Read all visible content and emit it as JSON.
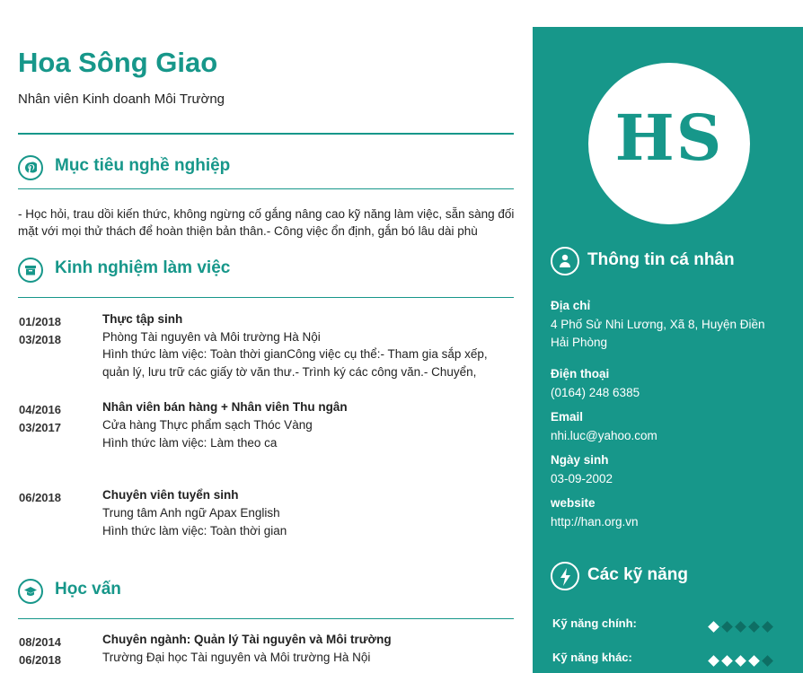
{
  "header": {
    "name": "Hoa Sông Giao",
    "position": "Nhân viên Kinh doanh Môi Trường"
  },
  "sections": {
    "objective": {
      "icon": "pinterest-icon",
      "title": "Mục tiêu nghề nghiệp",
      "text": "- Học hỏi, trau dồi kiến thức, không ngừng cố gắng nâng cao kỹ năng làm việc, sẵn sàng đối mặt với mọi thử thách để hoàn thiện bản thân.- Công việc ổn định, gắn bó lâu dài phù"
    },
    "experience": {
      "icon": "archive-icon",
      "title": "Kinh nghiệm làm việc",
      "items": [
        {
          "from": "01/2018",
          "to": "03/2018",
          "title": "Thực tập sinh",
          "org": "Phòng Tài nguyên và Môi trường Hà Nội",
          "desc": "Hình thức làm việc: Toàn thời gianCông việc cụ thể:- Tham gia sắp xếp, quản lý, lưu trữ các giấy tờ văn thư.- Trình ký các công văn.- Chuyển,"
        },
        {
          "from": "04/2016",
          "to": "03/2017",
          "title": "Nhân viên bán hàng + Nhân viên Thu ngân",
          "org": "Cửa hàng Thực phẩm sạch Thóc Vàng",
          "desc": "Hình thức làm việc: Làm theo ca"
        },
        {
          "from": "06/2018",
          "to": "",
          "title": "Chuyên viên tuyển sinh",
          "org": "Trung tâm Anh ngữ Apax English",
          "desc": "Hình thức làm việc: Toàn thời gian"
        }
      ]
    },
    "education": {
      "icon": "graduation-cap-icon",
      "title": "Học vấn",
      "items": [
        {
          "from": "08/2014",
          "to": "06/2018",
          "title": "Chuyên ngành: Quản lý Tài nguyên và Môi trường",
          "org": "Trường Đại học Tài nguyên và Môi trường Hà Nội"
        }
      ]
    }
  },
  "sidebar": {
    "initials": "HS",
    "personal_title": "Thông tin cá nhân",
    "personal_icon": "user-icon",
    "fields": [
      {
        "label": "Địa chỉ",
        "value": "4 Phố Sử Nhi Lương, Xã 8, Huyện Điền Hải Phòng"
      },
      {
        "label": "Điện thoại",
        "value": "(0164) 248 6385"
      },
      {
        "label": "Email",
        "value": "nhi.luc@yahoo.com"
      },
      {
        "label": "Ngày sinh",
        "value": "03-09-2002"
      },
      {
        "label": "website",
        "value": "http://han.org.vn"
      }
    ],
    "skills_title": "Các kỹ năng",
    "skills_icon": "bolt-icon",
    "skills": [
      {
        "label": "Kỹ năng chính:",
        "level": 1,
        "max": 5
      },
      {
        "label": "Kỹ năng khác:",
        "level": 4,
        "max": 5
      }
    ]
  },
  "colors": {
    "accent": "#17978a",
    "accent_dark": "#0e6e64",
    "text": "#222222"
  }
}
